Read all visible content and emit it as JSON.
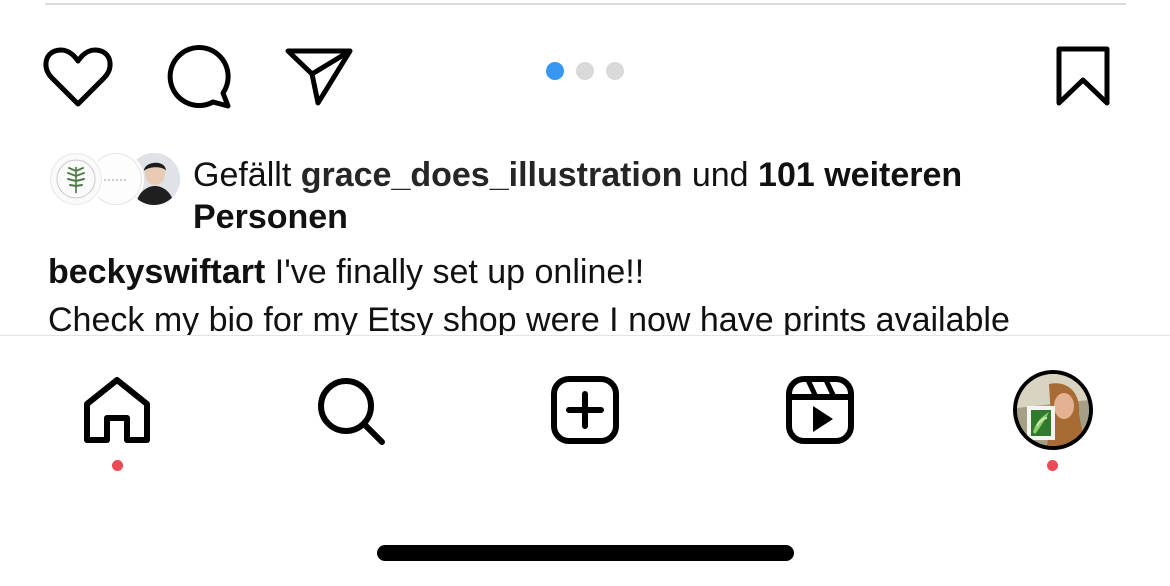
{
  "post": {
    "likes": {
      "prefix": "Gefällt",
      "liker": "grace_does_illustration",
      "connector": "und",
      "count_text": "101 weiteren",
      "suffix": "Personen"
    },
    "caption": {
      "username": "beckyswiftart",
      "line1": "I've finally set up online!!",
      "line2": "Check my bio for my Etsy shop were I now have prints available"
    },
    "carousel": {
      "current": 1,
      "total": 3
    },
    "actions": [
      "heart-icon",
      "comment-icon",
      "share-icon",
      "bookmark-icon"
    ]
  },
  "tabbar": {
    "tabs": [
      "home",
      "search",
      "create",
      "reels",
      "profile"
    ],
    "notification_dots": [
      "home",
      "profile"
    ]
  },
  "colors": {
    "accent": "#3897f0",
    "notification": "#ed4956",
    "dot_inactive": "#d9d9d9",
    "text": "#111111"
  }
}
